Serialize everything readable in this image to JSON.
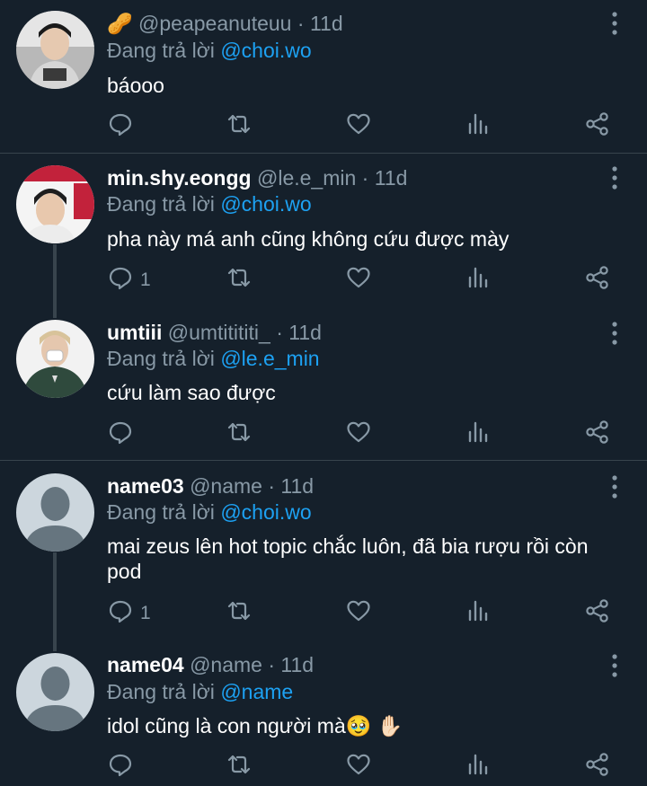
{
  "tweets": [
    {
      "display_name": "🥜",
      "handle": "@peapeanuteuu",
      "time": "11d",
      "reply_prefix": "Đang trả lời",
      "reply_to": "@choi.wo",
      "text": "báooo",
      "reply_count": "",
      "avatar_colors": [
        "#4a4a4a",
        "#d9d9d9"
      ]
    },
    {
      "display_name": "min.shy.eongg",
      "handle": "@le.e_min",
      "time": "11d",
      "reply_prefix": "Đang trả lời",
      "reply_to": "@choi.wo",
      "text": "pha này má anh cũng không cứu được mày",
      "reply_count": "1",
      "avatar_colors": [
        "#c2223b",
        "#f2f2f2"
      ]
    },
    {
      "display_name": "umtiii",
      "handle": "@umtitititi_",
      "time": "11d",
      "reply_prefix": "Đang trả lời",
      "reply_to": "@le.e_min",
      "text": "cứu làm sao được",
      "reply_count": "",
      "avatar_colors": [
        "#2f4a3d",
        "#e8e8e8"
      ]
    },
    {
      "display_name": "name03",
      "handle": "@name",
      "time": "11d",
      "reply_prefix": "Đang trả lời",
      "reply_to": "@choi.wo",
      "text": "mai zeus lên hot topic chắc luôn, đã bia rượu rồi còn pod",
      "reply_count": "1",
      "avatar_colors": [
        "#d1d5db",
        "#6b7280"
      ]
    },
    {
      "display_name": "name04",
      "handle": "@name",
      "time": "11d",
      "reply_prefix": "Đang trả lời",
      "reply_to": "@name",
      "text": "idol cũng là con người mà🥹 ✋🏻",
      "reply_count": "",
      "avatar_colors": [
        "#d1d5db",
        "#6b7280"
      ]
    }
  ],
  "separator_dot": "·",
  "icons": [
    "reply-icon",
    "retweet-icon",
    "like-icon",
    "analytics-icon",
    "share-icon",
    "more-icon"
  ],
  "colors": {
    "background": "#15202b",
    "secondary": "#8899a6",
    "link": "#1da1f2",
    "divider": "#38444d"
  }
}
